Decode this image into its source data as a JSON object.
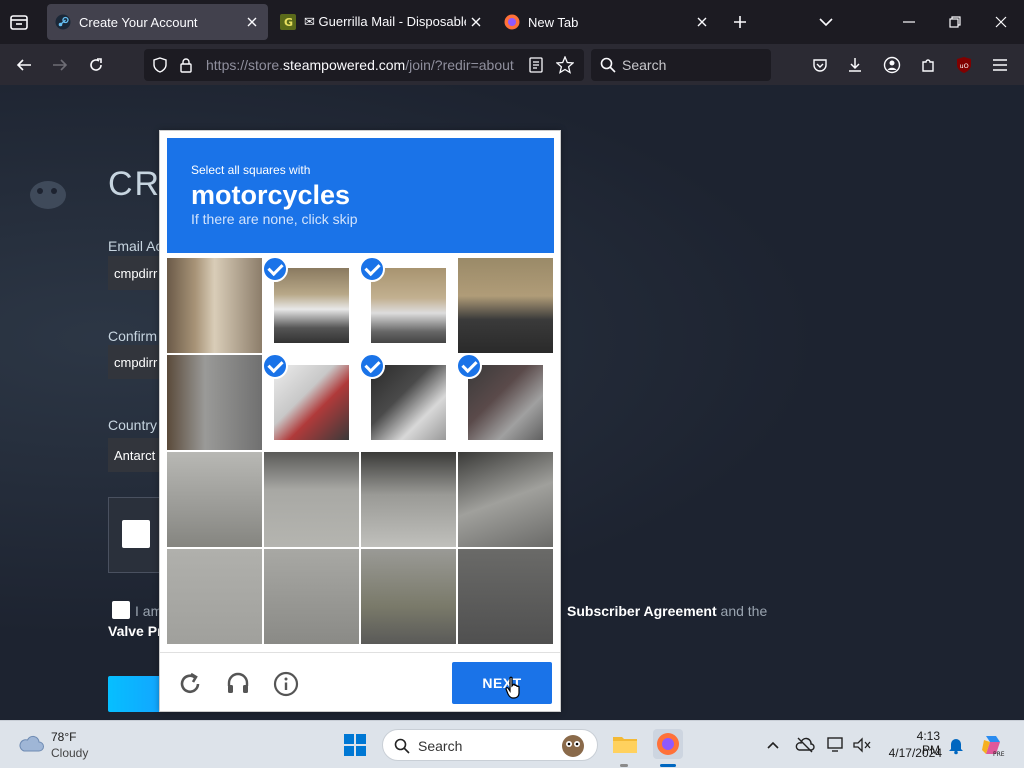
{
  "browser": {
    "tabs": [
      {
        "title": "Create Your Account",
        "active": true
      },
      {
        "title": "✉ Guerrilla Mail - Disposable Te",
        "active": false
      },
      {
        "title": "New Tab",
        "active": false
      }
    ],
    "url_prefix": "https://store.",
    "url_domain": "steampowered.com",
    "url_suffix": "/join/?redir=about",
    "search_placeholder": "Search"
  },
  "steam_page": {
    "title_visible": "CR",
    "email_label": "Email Ac",
    "email_value": "cmpdirr",
    "confirm_label": "Confirm",
    "confirm_value": "cmpdirr",
    "country_label": "Country",
    "country_value": "Antarct",
    "agree_prefix": "I am",
    "agree_link": "Subscriber Agreement",
    "agree_mid": "and the",
    "valve_text": "Valve Pr"
  },
  "recaptcha": {
    "instruction_pre": "Select all squares with",
    "keyword": "motorcycles",
    "instruction_sub": "If there are none, click skip",
    "selected_tiles": [
      1,
      2,
      5,
      6,
      7
    ],
    "next_label": "NEXT",
    "accent_color": "#1a73e8"
  },
  "taskbar": {
    "weather_temp": "78°F",
    "weather_desc": "Cloudy",
    "search_label": "Search",
    "time": "4:13 PM",
    "date": "4/17/2024"
  }
}
